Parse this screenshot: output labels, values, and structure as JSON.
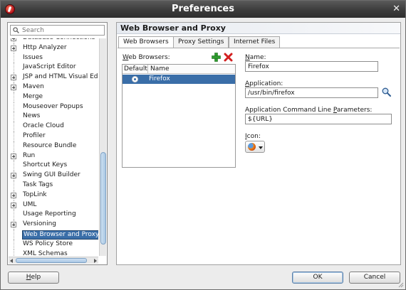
{
  "window": {
    "title": "Preferences",
    "close_glyph": "✕"
  },
  "search": {
    "placeholder": "Search",
    "value": ""
  },
  "tree": {
    "items": [
      {
        "label": "Database Connections",
        "expandable": true,
        "selected": false
      },
      {
        "label": "Http Analyzer",
        "expandable": true,
        "selected": false
      },
      {
        "label": "Issues",
        "expandable": false,
        "selected": false
      },
      {
        "label": "JavaScript Editor",
        "expandable": false,
        "selected": false
      },
      {
        "label": "JSP and HTML Visual Edit",
        "expandable": true,
        "selected": false
      },
      {
        "label": "Maven",
        "expandable": true,
        "selected": false
      },
      {
        "label": "Merge",
        "expandable": false,
        "selected": false
      },
      {
        "label": "Mouseover Popups",
        "expandable": false,
        "selected": false
      },
      {
        "label": "News",
        "expandable": false,
        "selected": false
      },
      {
        "label": "Oracle Cloud",
        "expandable": false,
        "selected": false
      },
      {
        "label": "Profiler",
        "expandable": false,
        "selected": false
      },
      {
        "label": "Resource Bundle",
        "expandable": false,
        "selected": false
      },
      {
        "label": "Run",
        "expandable": true,
        "selected": false
      },
      {
        "label": "Shortcut Keys",
        "expandable": false,
        "selected": false
      },
      {
        "label": "Swing GUI Builder",
        "expandable": true,
        "selected": false
      },
      {
        "label": "Task Tags",
        "expandable": false,
        "selected": false
      },
      {
        "label": "TopLink",
        "expandable": true,
        "selected": false
      },
      {
        "label": "UML",
        "expandable": true,
        "selected": false
      },
      {
        "label": "Usage Reporting",
        "expandable": false,
        "selected": false
      },
      {
        "label": "Versioning",
        "expandable": true,
        "selected": false
      },
      {
        "label": "Web Browser and Proxy",
        "expandable": false,
        "selected": true
      },
      {
        "label": "WS Policy Store",
        "expandable": false,
        "selected": false
      },
      {
        "label": "XML Schemas",
        "expandable": false,
        "selected": false
      }
    ]
  },
  "panel": {
    "title": "Web Browser and Proxy",
    "tabs": [
      {
        "label": "Web Browsers",
        "active": true
      },
      {
        "label": "Proxy Settings",
        "active": false
      },
      {
        "label": "Internet Files",
        "active": false
      }
    ]
  },
  "browsers": {
    "label_mnemonic": "W",
    "label_rest": "eb Browsers:",
    "columns": [
      "Default",
      "Name"
    ],
    "rows": [
      {
        "name": "Firefox",
        "default": true
      }
    ]
  },
  "form": {
    "name_mnemonic": "N",
    "name_rest": "ame:",
    "name_value": "Firefox",
    "application_mnemonic": "A",
    "application_rest": "pplication:",
    "application_value": "/usr/bin/firefox",
    "params_pre": "Application Command Line ",
    "params_mnemonic": "P",
    "params_post": "arameters:",
    "params_value": "${URL}",
    "icon_mnemonic": "I",
    "icon_rest": "con:",
    "icon_name": "firefox-icon"
  },
  "buttons": {
    "help_mnemonic": "H",
    "help_rest": "elp",
    "ok": "OK",
    "cancel": "Cancel"
  },
  "colors": {
    "selection": "#3a6ea8",
    "add": "#2e9b2e",
    "delete": "#d21f1f"
  }
}
